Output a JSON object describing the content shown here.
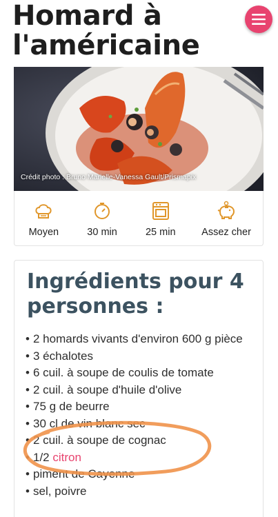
{
  "header": {
    "title": "Homard à l'américaine",
    "menu_icon": "hamburger-menu-icon",
    "accent_color": "#e8436f"
  },
  "photo": {
    "credit": "Crédit photo : Bruno Marielle-Vanessa Gault/Prismapix"
  },
  "info": [
    {
      "icon": "chef-hat-icon",
      "label": "Moyen"
    },
    {
      "icon": "timer-icon",
      "label": "30 min"
    },
    {
      "icon": "oven-icon",
      "label": "25 min"
    },
    {
      "icon": "piggy-bank-icon",
      "label": "Assez cher"
    }
  ],
  "ingredients": {
    "title": "Ingrédients pour 4 personnes :",
    "title_color": "#3c5260",
    "items": [
      "2 homards vivants d'environ 600 g pièce",
      "3 échalotes",
      "6 cuil. à soupe de coulis de tomate",
      "2 cuil. à soupe d'huile d'olive",
      "75 g de beurre",
      "30 cl de vin blanc sec",
      "2 cuil. à soupe de cognac",
      "1/2",
      "piment de Cayenne",
      "sel, poivre"
    ],
    "link_word": "citron"
  },
  "annotation_color": "#f0924a"
}
